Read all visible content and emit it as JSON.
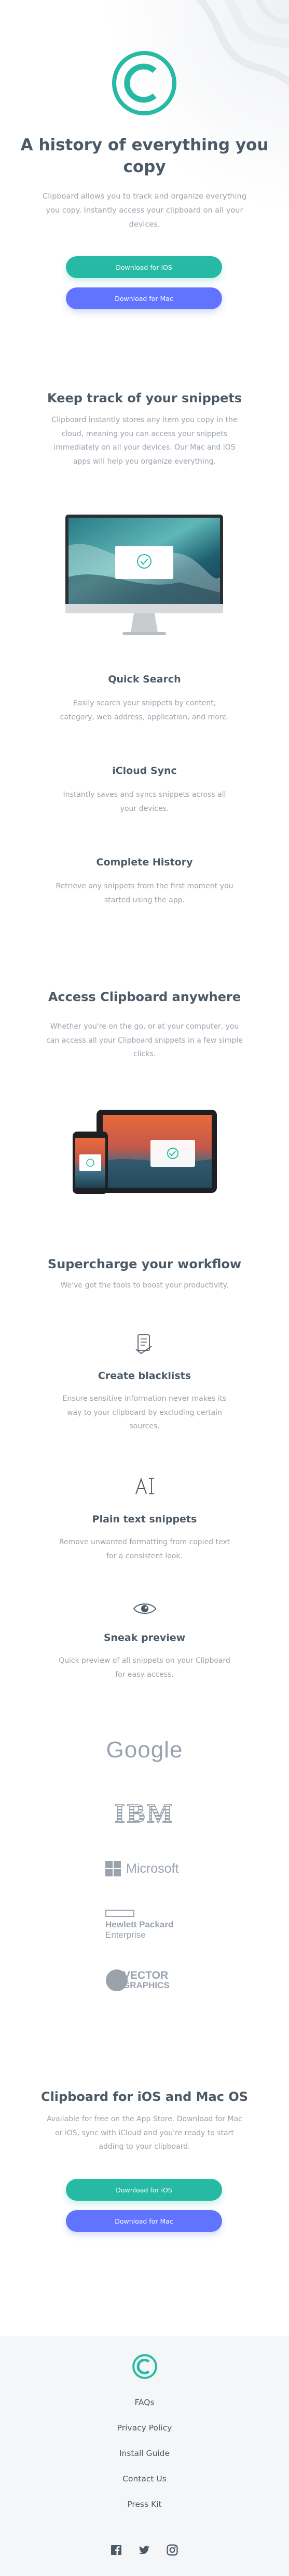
{
  "hero": {
    "title_line1": "A history of everything you",
    "title_line2": "copy",
    "lead_line1": "Clipboard allows you to track and organize everything",
    "lead_line2": "you copy. Instantly access your clipboard on all your",
    "lead_line3": "devices.",
    "ios_button": "Download for iOS",
    "mac_button": "Download for Mac"
  },
  "snippets": {
    "title": "Keep track of your snippets",
    "text_line1": "Clipboard instantly stores any item you copy in the",
    "text_line2": "cloud, meaning you can access your snippets",
    "text_line3": "immediately on all your devices. Our Mac and iOS",
    "text_line4": "apps will help you organize everything."
  },
  "features": [
    {
      "title": "Quick Search",
      "line1": "Easily search your snippets by content,",
      "line2": "category, web address, application, and more."
    },
    {
      "title": "iCloud Sync",
      "line1": "Instantly saves and syncs snippets across all",
      "line2": "your devices."
    },
    {
      "title": "Complete History",
      "line1": "Retrieve any snippets from the first moment you",
      "line2": "started using the app."
    }
  ],
  "access": {
    "title": "Access Clipboard anywhere",
    "line1": "Whether you're on the go, or at your computer, you",
    "line2": "can access all your Clipboard snippets in a few simple",
    "line3": "clicks."
  },
  "workflow": {
    "title": "Supercharge your workflow",
    "subtitle": "We've got the tools to boost your productivity.",
    "items": [
      {
        "title": "Create blacklists",
        "line1": "Ensure sensitive information never makes its",
        "line2": "way to your clipboard by excluding certain",
        "line3": "sources."
      },
      {
        "title": "Plain text snippets",
        "line1": "Remove unwanted formatting from copied text",
        "line2": "for a consistent look.",
        "line3": ""
      },
      {
        "title": "Sneak preview",
        "line1": "Quick preview of all snippets on your Clipboard",
        "line2": "for easy access.",
        "line3": ""
      }
    ]
  },
  "brands": {
    "google": "Google",
    "ibm": "IBM",
    "microsoft": "Microsoft",
    "hp_line1": "Hewlett Packard",
    "hp_line2": "Enterprise",
    "vector_line1": "VECTOR",
    "vector_line2": "GRAPHICS"
  },
  "cta": {
    "title": "Clipboard for iOS and Mac OS",
    "line1": "Available for free on the App Store. Download for Mac",
    "line2": "or iOS, sync with iCloud and you're ready to start",
    "line3": "adding to your clipboard.",
    "ios_button": "Download for iOS",
    "mac_button": "Download for Mac"
  },
  "footer": {
    "links": [
      "FAQs",
      "Privacy Policy",
      "Install Guide",
      "Contact Us",
      "Press Kit"
    ],
    "social": [
      "facebook-icon",
      "twitter-icon",
      "instagram-icon"
    ]
  },
  "colors": {
    "accent": "#26baa4",
    "secondary": "#6174ff",
    "heading": "#4c5a67",
    "muted": "#9ba4ae",
    "footer_bg": "#f5f6f8"
  }
}
